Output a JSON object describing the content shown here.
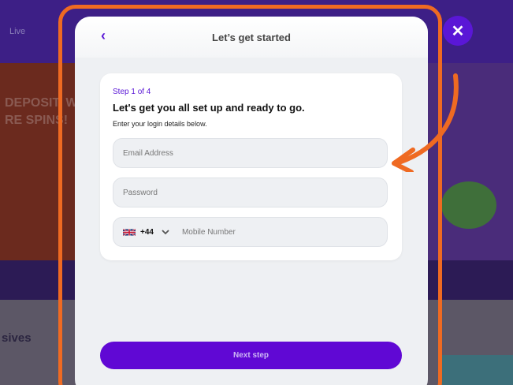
{
  "background": {
    "topbar_label": "Live",
    "hero_text": "DEPOSIT, W\nRE SPINS!",
    "lower_text": "sives"
  },
  "modal": {
    "title": "Let’s get started",
    "back_icon": "chevron-left-icon",
    "close_icon": "close-icon",
    "card": {
      "step": "Step 1 of 4",
      "heading": "Let's get you all set up and ready to go.",
      "subtext": "Enter your login details below."
    },
    "fields": {
      "email_placeholder": "Email Address",
      "password_placeholder": "Password",
      "country_flag": "uk-flag-icon",
      "dial_code": "+44",
      "mobile_placeholder": "Mobile Number"
    },
    "next_label": "Next step"
  },
  "colors": {
    "accent": "#6008d4",
    "highlight": "#ef6a22"
  }
}
